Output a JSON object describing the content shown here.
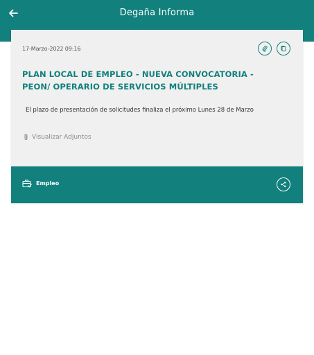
{
  "header": {
    "title": "Degaña Informa",
    "back_icon": "arrow-left-icon"
  },
  "news": {
    "date": "17-Marzo-2022 09:16",
    "title": "PLAN LOCAL DE EMPLEO - NUEVA CONVOCATORIA - PEON/ OPERARIO DE SERVICIOS MÚLTIPLES",
    "body": "El plazo de presentación de solicitudes finaliza el próximo Lunes 28 de Marzo",
    "attachments_label": "Visualizar Adjuntos",
    "category": "Empleo",
    "icons": [
      "paperclip-icon",
      "copy-icon",
      "briefcase-icon",
      "share-icon"
    ]
  },
  "colors": {
    "primary": "#12807d",
    "card_bg": "#f0f0f0"
  }
}
